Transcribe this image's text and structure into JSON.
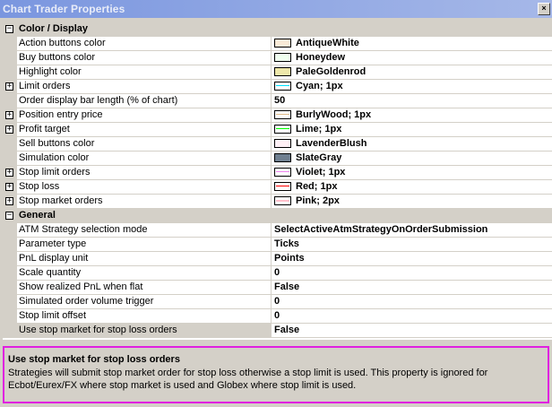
{
  "window": {
    "title": "Chart Trader Properties",
    "close_glyph": "×"
  },
  "categories": [
    {
      "label": "Color / Display",
      "toggle": "−",
      "rows": [
        {
          "name": "Action buttons color",
          "value": "AntiqueWhite",
          "swatch": "#faebd7",
          "expandable": false
        },
        {
          "name": "Buy buttons color",
          "value": "Honeydew",
          "swatch": "#f0fff0",
          "expandable": false
        },
        {
          "name": "Highlight color",
          "value": "PaleGoldenrod",
          "swatch": "#eee8aa",
          "expandable": false
        },
        {
          "name": "Limit orders",
          "value": "Cyan; 1px",
          "swatch": "#ffffff",
          "line": "#00e0ff",
          "expandable": true
        },
        {
          "name": "Order display bar length (% of chart)",
          "value": "50",
          "expandable": false
        },
        {
          "name": "Position entry price",
          "value": "BurlyWood; 1px",
          "swatch": "#ffffff",
          "line": "#deb887",
          "expandable": true
        },
        {
          "name": "Profit target",
          "value": "Lime; 1px",
          "swatch": "#ffffff",
          "line": "#00ff00",
          "expandable": true
        },
        {
          "name": "Sell buttons color",
          "value": "LavenderBlush",
          "swatch": "#fff0f5",
          "expandable": false
        },
        {
          "name": "Simulation color",
          "value": "SlateGray",
          "swatch": "#708090",
          "expandable": false
        },
        {
          "name": "Stop limit orders",
          "value": "Violet; 1px",
          "swatch": "#ffffff",
          "line": "#ee82ee",
          "expandable": true
        },
        {
          "name": "Stop loss",
          "value": "Red; 1px",
          "swatch": "#ffffff",
          "line": "#ff0000",
          "expandable": true
        },
        {
          "name": "Stop market orders",
          "value": "Pink; 2px",
          "swatch": "#ffffff",
          "line": "#ffc0cb",
          "expandable": true
        }
      ]
    },
    {
      "label": "General",
      "toggle": "−",
      "rows": [
        {
          "name": "ATM Strategy selection mode",
          "value": "SelectActiveAtmStrategyOnOrderSubmission",
          "expandable": false
        },
        {
          "name": "Parameter type",
          "value": "Ticks",
          "expandable": false
        },
        {
          "name": "PnL display unit",
          "value": "Points",
          "expandable": false
        },
        {
          "name": "Scale quantity",
          "value": "0",
          "expandable": false
        },
        {
          "name": "Show realized PnL when flat",
          "value": "False",
          "expandable": false
        },
        {
          "name": "Simulated order volume trigger",
          "value": "0",
          "expandable": false
        },
        {
          "name": "Stop limit offset",
          "value": "0",
          "expandable": false
        },
        {
          "name": "Use stop market for stop loss orders",
          "value": "False",
          "expandable": false,
          "selected": true
        }
      ]
    }
  ],
  "description": {
    "title": "Use stop market for stop loss orders",
    "text": "Strategies will submit stop market order for stop loss otherwise a stop limit is used. This property is ignored for Ecbot/Eurex/FX where stop market is used and Globex where stop limit is used."
  }
}
